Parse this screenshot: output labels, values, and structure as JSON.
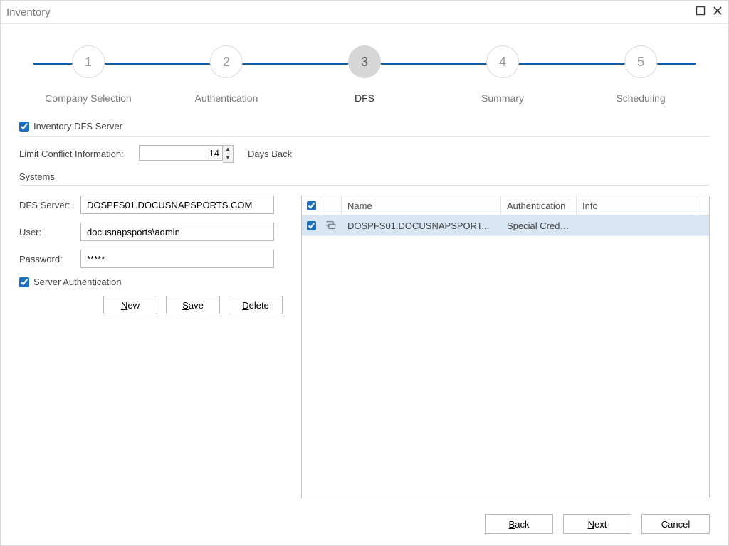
{
  "window": {
    "title": "Inventory"
  },
  "stepper": {
    "steps": [
      {
        "num": "1",
        "label": "Company Selection"
      },
      {
        "num": "2",
        "label": "Authentication"
      },
      {
        "num": "3",
        "label": "DFS"
      },
      {
        "num": "4",
        "label": "Summary"
      },
      {
        "num": "5",
        "label": "Scheduling"
      }
    ],
    "active_index": 2
  },
  "form": {
    "inventory_checkbox_label": "Inventory DFS Server",
    "inventory_checked": true,
    "limit_label": "Limit Conflict Information:",
    "limit_value": "14",
    "days_back_label": "Days Back",
    "systems_heading": "Systems",
    "fields": {
      "dfs_server_label": "DFS Server:",
      "dfs_server_value": "DOSPFS01.DOCUSNAPSPORTS.COM",
      "user_label": "User:",
      "user_value": "docusnapsports\\admin",
      "password_label": "Password:",
      "password_value": "*****"
    },
    "server_auth_label": "Server Authentication",
    "server_auth_checked": true,
    "buttons": {
      "new_": "New",
      "save": "Save",
      "delete_": "Delete"
    }
  },
  "grid": {
    "header_checked": true,
    "columns": {
      "name": "Name",
      "auth": "Authentication",
      "info": "Info"
    },
    "rows": [
      {
        "checked": true,
        "name": "DOSPFS01.DOCUSNAPSPORT...",
        "auth": "Special Crede...",
        "info": ""
      }
    ]
  },
  "footer": {
    "back": "Back",
    "next": "Next",
    "cancel": "Cancel"
  }
}
